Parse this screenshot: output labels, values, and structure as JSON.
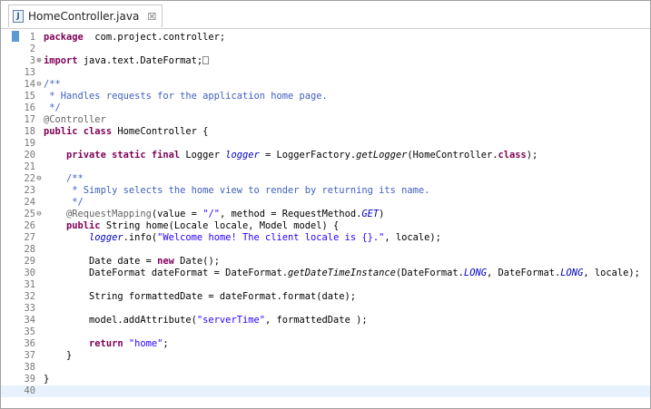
{
  "tab": {
    "title": "HomeController.java",
    "close_glyph": "☒",
    "icon_letter": "J"
  },
  "colors": {
    "keyword": "#7f0055",
    "comment": "#3f5fbf",
    "string": "#2a00ff",
    "annotation": "#646464",
    "field": "#0000c0",
    "current_line": "#e8f2fe"
  },
  "lines": [
    {
      "n": "1",
      "fold": "",
      "t": [
        [
          "kw",
          "package"
        ],
        [
          "",
          "  com.project.controller;"
        ]
      ]
    },
    {
      "n": "2",
      "fold": "",
      "t": []
    },
    {
      "n": "3",
      "fold": "plus",
      "t": [
        [
          "kw",
          "import"
        ],
        [
          "",
          " java.text.DateFormat;"
        ],
        [
          "box",
          ""
        ]
      ]
    },
    {
      "n": "13",
      "fold": "",
      "t": []
    },
    {
      "n": "14",
      "fold": "minus",
      "t": [
        [
          "cm",
          "/**"
        ]
      ]
    },
    {
      "n": "15",
      "fold": "",
      "t": [
        [
          "cm",
          " * Handles requests for the application home page."
        ]
      ]
    },
    {
      "n": "16",
      "fold": "",
      "t": [
        [
          "cm",
          " */"
        ]
      ]
    },
    {
      "n": "17",
      "fold": "",
      "t": [
        [
          "ann",
          "@Controller"
        ]
      ]
    },
    {
      "n": "18",
      "fold": "",
      "t": [
        [
          "kw",
          "public class"
        ],
        [
          "",
          " HomeController {"
        ]
      ]
    },
    {
      "n": "19",
      "fold": "",
      "t": []
    },
    {
      "n": "20",
      "fold": "",
      "t": [
        [
          "",
          "    "
        ],
        [
          "kw",
          "private static final"
        ],
        [
          "",
          " Logger "
        ],
        [
          "fld",
          "logger"
        ],
        [
          "",
          " = LoggerFactory."
        ],
        [
          "st",
          "getLogger"
        ],
        [
          "",
          "(HomeController."
        ],
        [
          "kw",
          "class"
        ],
        [
          "",
          ");"
        ]
      ]
    },
    {
      "n": "21",
      "fold": "",
      "t": []
    },
    {
      "n": "22",
      "fold": "minus",
      "t": [
        [
          "",
          "    "
        ],
        [
          "cm",
          "/**"
        ]
      ]
    },
    {
      "n": "23",
      "fold": "",
      "t": [
        [
          "",
          "    "
        ],
        [
          "cm",
          " * Simply selects the home view to render by returning its name."
        ]
      ]
    },
    {
      "n": "24",
      "fold": "",
      "t": [
        [
          "",
          "    "
        ],
        [
          "cm",
          " */"
        ]
      ]
    },
    {
      "n": "25",
      "fold": "minus",
      "t": [
        [
          "",
          "    "
        ],
        [
          "ann",
          "@RequestMapping"
        ],
        [
          "",
          "(value = "
        ],
        [
          "str",
          "\"/\""
        ],
        [
          "",
          ", method = RequestMethod."
        ],
        [
          "fld",
          "GET"
        ],
        [
          "",
          ")"
        ]
      ]
    },
    {
      "n": "26",
      "fold": "",
      "t": [
        [
          "",
          "    "
        ],
        [
          "kw",
          "public"
        ],
        [
          "",
          " String home(Locale locale, Model model) {"
        ]
      ]
    },
    {
      "n": "27",
      "fold": "",
      "t": [
        [
          "",
          "        "
        ],
        [
          "fld",
          "logger"
        ],
        [
          "",
          ".info("
        ],
        [
          "str",
          "\"Welcome home! The client locale is {}.\""
        ],
        [
          "",
          ", locale);"
        ]
      ]
    },
    {
      "n": "28",
      "fold": "",
      "t": []
    },
    {
      "n": "29",
      "fold": "",
      "t": [
        [
          "",
          "        Date date = "
        ],
        [
          "kw",
          "new"
        ],
        [
          "",
          " Date();"
        ]
      ]
    },
    {
      "n": "30",
      "fold": "",
      "t": [
        [
          "",
          "        DateFormat dateFormat = DateFormat."
        ],
        [
          "st",
          "getDateTimeInstance"
        ],
        [
          "",
          "(DateFormat."
        ],
        [
          "fld",
          "LONG"
        ],
        [
          "",
          ", DateFormat."
        ],
        [
          "fld",
          "LONG"
        ],
        [
          "",
          ", locale);"
        ]
      ]
    },
    {
      "n": "31",
      "fold": "",
      "t": []
    },
    {
      "n": "32",
      "fold": "",
      "t": [
        [
          "",
          "        String formattedDate = dateFormat.format(date);"
        ]
      ]
    },
    {
      "n": "33",
      "fold": "",
      "t": []
    },
    {
      "n": "34",
      "fold": "",
      "t": [
        [
          "",
          "        model.addAttribute("
        ],
        [
          "str",
          "\"serverTime\""
        ],
        [
          "",
          ", formattedDate );"
        ]
      ]
    },
    {
      "n": "35",
      "fold": "",
      "t": []
    },
    {
      "n": "36",
      "fold": "",
      "t": [
        [
          "",
          "        "
        ],
        [
          "kw",
          "return"
        ],
        [
          "",
          " "
        ],
        [
          "str",
          "\"home\""
        ],
        [
          "",
          ";"
        ]
      ]
    },
    {
      "n": "37",
      "fold": "",
      "t": [
        [
          "",
          "    }"
        ]
      ]
    },
    {
      "n": "38",
      "fold": "",
      "t": []
    },
    {
      "n": "39",
      "fold": "",
      "t": [
        [
          "",
          "}"
        ]
      ]
    },
    {
      "n": "40",
      "fold": "",
      "t": [],
      "current": true
    }
  ]
}
